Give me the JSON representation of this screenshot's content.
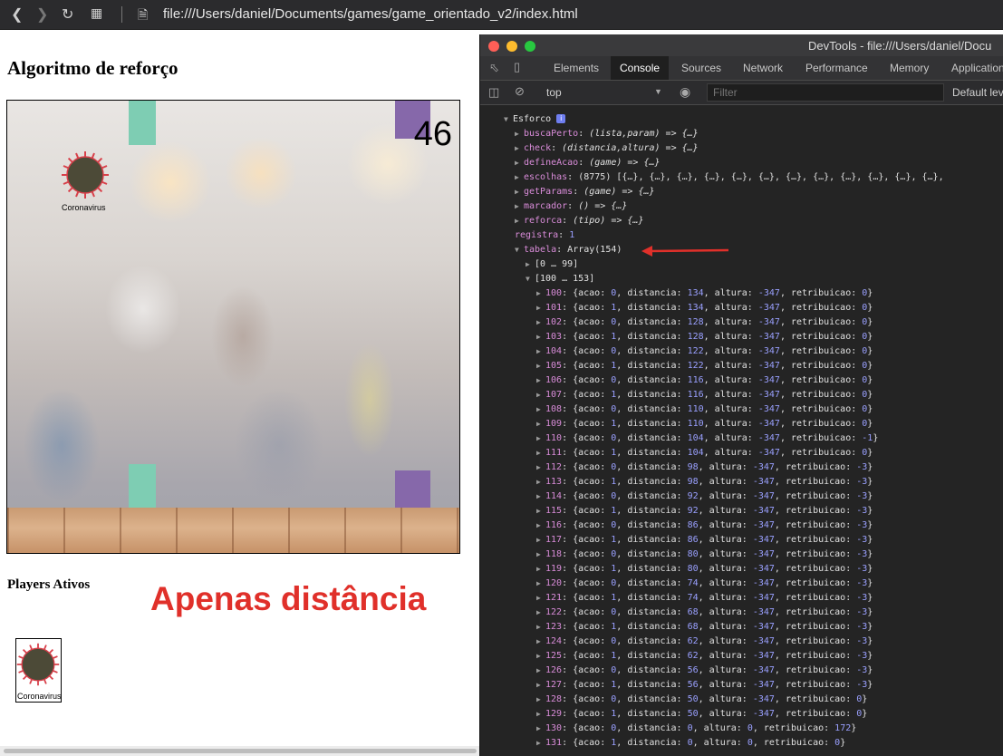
{
  "browser": {
    "address": "file:///Users/daniel/Documents/games/game_orientado_v2/index.html"
  },
  "page": {
    "title": "Algoritmo de reforço",
    "score": "46",
    "sprite_label": "Coronavirus",
    "players_title": "Players Ativos",
    "player_label": "Coronavirus",
    "annotation": "Apenas distância",
    "colors": {
      "pipe_green": "#7ecdb3",
      "pipe_purple": "#8668aa",
      "annotation_red": "#e0302a",
      "virus_body": "#4c4a37",
      "virus_spikes": "#d8404a"
    }
  },
  "devtools": {
    "window_title": "DevTools - file:///Users/daniel/Docu",
    "tabs": [
      "Elements",
      "Console",
      "Sources",
      "Network",
      "Performance",
      "Memory",
      "Application"
    ],
    "active_tab": "Console",
    "context": "top",
    "filter_placeholder": "Filter",
    "levels": "Default lev",
    "object_name": "Esforco",
    "props": [
      {
        "key": "buscaPerto",
        "sig": "(lista,param) => {…}"
      },
      {
        "key": "check",
        "sig": "(distancia,altura) => {…}"
      },
      {
        "key": "defineAcao",
        "sig": "(game) => {…}"
      },
      {
        "key": "escolhas",
        "sig": "(8775) [{…}, {…}, {…}, {…}, {…}, {…}, {…}, {…}, {…}, {…}, {…}, {…},"
      },
      {
        "key": "getParams",
        "sig": "(game) => {…}"
      },
      {
        "key": "marcador",
        "sig": "() => {…}"
      },
      {
        "key": "reforca",
        "sig": "(tipo) => {…}"
      }
    ],
    "registra": "1",
    "tabela": "Array(154)",
    "range_collapsed": "[0 … 99]",
    "range_expanded": "[100 … 153]",
    "rows": [
      {
        "i": "100",
        "acao": "0",
        "distancia": "134",
        "altura": "-347",
        "retribuicao": "0"
      },
      {
        "i": "101",
        "acao": "1",
        "distancia": "134",
        "altura": "-347",
        "retribuicao": "0"
      },
      {
        "i": "102",
        "acao": "0",
        "distancia": "128",
        "altura": "-347",
        "retribuicao": "0"
      },
      {
        "i": "103",
        "acao": "1",
        "distancia": "128",
        "altura": "-347",
        "retribuicao": "0"
      },
      {
        "i": "104",
        "acao": "0",
        "distancia": "122",
        "altura": "-347",
        "retribuicao": "0"
      },
      {
        "i": "105",
        "acao": "1",
        "distancia": "122",
        "altura": "-347",
        "retribuicao": "0"
      },
      {
        "i": "106",
        "acao": "0",
        "distancia": "116",
        "altura": "-347",
        "retribuicao": "0"
      },
      {
        "i": "107",
        "acao": "1",
        "distancia": "116",
        "altura": "-347",
        "retribuicao": "0"
      },
      {
        "i": "108",
        "acao": "0",
        "distancia": "110",
        "altura": "-347",
        "retribuicao": "0"
      },
      {
        "i": "109",
        "acao": "1",
        "distancia": "110",
        "altura": "-347",
        "retribuicao": "0"
      },
      {
        "i": "110",
        "acao": "0",
        "distancia": "104",
        "altura": "-347",
        "retribuicao": "-1"
      },
      {
        "i": "111",
        "acao": "1",
        "distancia": "104",
        "altura": "-347",
        "retribuicao": "0"
      },
      {
        "i": "112",
        "acao": "0",
        "distancia": "98",
        "altura": "-347",
        "retribuicao": "-3"
      },
      {
        "i": "113",
        "acao": "1",
        "distancia": "98",
        "altura": "-347",
        "retribuicao": "-3"
      },
      {
        "i": "114",
        "acao": "0",
        "distancia": "92",
        "altura": "-347",
        "retribuicao": "-3"
      },
      {
        "i": "115",
        "acao": "1",
        "distancia": "92",
        "altura": "-347",
        "retribuicao": "-3"
      },
      {
        "i": "116",
        "acao": "0",
        "distancia": "86",
        "altura": "-347",
        "retribuicao": "-3"
      },
      {
        "i": "117",
        "acao": "1",
        "distancia": "86",
        "altura": "-347",
        "retribuicao": "-3"
      },
      {
        "i": "118",
        "acao": "0",
        "distancia": "80",
        "altura": "-347",
        "retribuicao": "-3"
      },
      {
        "i": "119",
        "acao": "1",
        "distancia": "80",
        "altura": "-347",
        "retribuicao": "-3"
      },
      {
        "i": "120",
        "acao": "0",
        "distancia": "74",
        "altura": "-347",
        "retribuicao": "-3"
      },
      {
        "i": "121",
        "acao": "1",
        "distancia": "74",
        "altura": "-347",
        "retribuicao": "-3"
      },
      {
        "i": "122",
        "acao": "0",
        "distancia": "68",
        "altura": "-347",
        "retribuicao": "-3"
      },
      {
        "i": "123",
        "acao": "1",
        "distancia": "68",
        "altura": "-347",
        "retribuicao": "-3"
      },
      {
        "i": "124",
        "acao": "0",
        "distancia": "62",
        "altura": "-347",
        "retribuicao": "-3"
      },
      {
        "i": "125",
        "acao": "1",
        "distancia": "62",
        "altura": "-347",
        "retribuicao": "-3"
      },
      {
        "i": "126",
        "acao": "0",
        "distancia": "56",
        "altura": "-347",
        "retribuicao": "-3"
      },
      {
        "i": "127",
        "acao": "1",
        "distancia": "56",
        "altura": "-347",
        "retribuicao": "-3"
      },
      {
        "i": "128",
        "acao": "0",
        "distancia": "50",
        "altura": "-347",
        "retribuicao": "0"
      },
      {
        "i": "129",
        "acao": "1",
        "distancia": "50",
        "altura": "-347",
        "retribuicao": "0"
      },
      {
        "i": "130",
        "acao": "0",
        "distancia": "0",
        "altura": "0",
        "retribuicao": "172"
      },
      {
        "i": "131",
        "acao": "1",
        "distancia": "0",
        "altura": "0",
        "retribuicao": "0"
      }
    ]
  }
}
